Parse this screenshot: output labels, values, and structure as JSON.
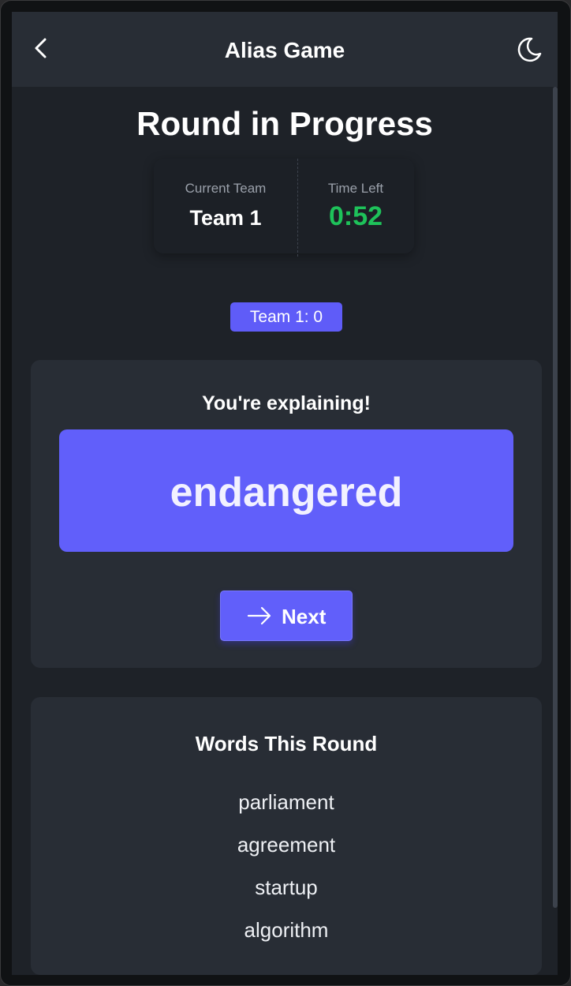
{
  "header": {
    "title": "Alias Game",
    "back_icon": "chevron-left-icon",
    "theme_icon": "moon-icon"
  },
  "round": {
    "title": "Round in Progress",
    "current_team_label": "Current Team",
    "current_team": "Team 1",
    "time_left_label": "Time Left",
    "time_left": "0:52",
    "timer_color": "#1ec25a"
  },
  "score": {
    "badge": "Team 1: 0"
  },
  "word_card": {
    "role_text": "You're explaining!",
    "word": "endangered",
    "next_label": "Next",
    "next_icon": "arrow-right-icon"
  },
  "words_round": {
    "title": "Words This Round",
    "words": [
      "parliament",
      "agreement",
      "startup",
      "algorithm"
    ]
  },
  "colors": {
    "accent": "#615ffa",
    "background": "#1e2228",
    "card": "#282d35"
  }
}
